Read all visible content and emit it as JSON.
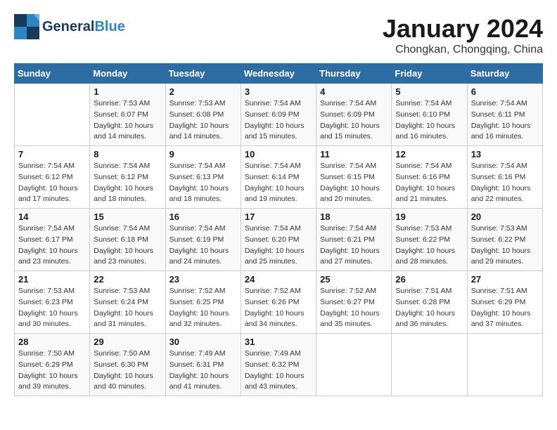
{
  "header": {
    "logo_line1": "General",
    "logo_line2": "Blue",
    "month": "January 2024",
    "location": "Chongkan, Chongqing, China"
  },
  "days_of_week": [
    "Sunday",
    "Monday",
    "Tuesday",
    "Wednesday",
    "Thursday",
    "Friday",
    "Saturday"
  ],
  "weeks": [
    [
      {
        "day": "",
        "info": ""
      },
      {
        "day": "1",
        "info": "Sunrise: 7:53 AM\nSunset: 6:07 PM\nDaylight: 10 hours\nand 14 minutes."
      },
      {
        "day": "2",
        "info": "Sunrise: 7:53 AM\nSunset: 6:08 PM\nDaylight: 10 hours\nand 14 minutes."
      },
      {
        "day": "3",
        "info": "Sunrise: 7:54 AM\nSunset: 6:09 PM\nDaylight: 10 hours\nand 15 minutes."
      },
      {
        "day": "4",
        "info": "Sunrise: 7:54 AM\nSunset: 6:09 PM\nDaylight: 10 hours\nand 15 minutes."
      },
      {
        "day": "5",
        "info": "Sunrise: 7:54 AM\nSunset: 6:10 PM\nDaylight: 10 hours\nand 16 minutes."
      },
      {
        "day": "6",
        "info": "Sunrise: 7:54 AM\nSunset: 6:11 PM\nDaylight: 10 hours\nand 16 minutes."
      }
    ],
    [
      {
        "day": "7",
        "info": "Sunrise: 7:54 AM\nSunset: 6:12 PM\nDaylight: 10 hours\nand 17 minutes."
      },
      {
        "day": "8",
        "info": "Sunrise: 7:54 AM\nSunset: 6:12 PM\nDaylight: 10 hours\nand 18 minutes."
      },
      {
        "day": "9",
        "info": "Sunrise: 7:54 AM\nSunset: 6:13 PM\nDaylight: 10 hours\nand 18 minutes."
      },
      {
        "day": "10",
        "info": "Sunrise: 7:54 AM\nSunset: 6:14 PM\nDaylight: 10 hours\nand 19 minutes."
      },
      {
        "day": "11",
        "info": "Sunrise: 7:54 AM\nSunset: 6:15 PM\nDaylight: 10 hours\nand 20 minutes."
      },
      {
        "day": "12",
        "info": "Sunrise: 7:54 AM\nSunset: 6:16 PM\nDaylight: 10 hours\nand 21 minutes."
      },
      {
        "day": "13",
        "info": "Sunrise: 7:54 AM\nSunset: 6:16 PM\nDaylight: 10 hours\nand 22 minutes."
      }
    ],
    [
      {
        "day": "14",
        "info": "Sunrise: 7:54 AM\nSunset: 6:17 PM\nDaylight: 10 hours\nand 23 minutes."
      },
      {
        "day": "15",
        "info": "Sunrise: 7:54 AM\nSunset: 6:18 PM\nDaylight: 10 hours\nand 23 minutes."
      },
      {
        "day": "16",
        "info": "Sunrise: 7:54 AM\nSunset: 6:19 PM\nDaylight: 10 hours\nand 24 minutes."
      },
      {
        "day": "17",
        "info": "Sunrise: 7:54 AM\nSunset: 6:20 PM\nDaylight: 10 hours\nand 25 minutes."
      },
      {
        "day": "18",
        "info": "Sunrise: 7:54 AM\nSunset: 6:21 PM\nDaylight: 10 hours\nand 27 minutes."
      },
      {
        "day": "19",
        "info": "Sunrise: 7:53 AM\nSunset: 6:22 PM\nDaylight: 10 hours\nand 28 minutes."
      },
      {
        "day": "20",
        "info": "Sunrise: 7:53 AM\nSunset: 6:22 PM\nDaylight: 10 hours\nand 29 minutes."
      }
    ],
    [
      {
        "day": "21",
        "info": "Sunrise: 7:53 AM\nSunset: 6:23 PM\nDaylight: 10 hours\nand 30 minutes."
      },
      {
        "day": "22",
        "info": "Sunrise: 7:53 AM\nSunset: 6:24 PM\nDaylight: 10 hours\nand 31 minutes."
      },
      {
        "day": "23",
        "info": "Sunrise: 7:52 AM\nSunset: 6:25 PM\nDaylight: 10 hours\nand 32 minutes."
      },
      {
        "day": "24",
        "info": "Sunrise: 7:52 AM\nSunset: 6:26 PM\nDaylight: 10 hours\nand 34 minutes."
      },
      {
        "day": "25",
        "info": "Sunrise: 7:52 AM\nSunset: 6:27 PM\nDaylight: 10 hours\nand 35 minutes."
      },
      {
        "day": "26",
        "info": "Sunrise: 7:51 AM\nSunset: 6:28 PM\nDaylight: 10 hours\nand 36 minutes."
      },
      {
        "day": "27",
        "info": "Sunrise: 7:51 AM\nSunset: 6:29 PM\nDaylight: 10 hours\nand 37 minutes."
      }
    ],
    [
      {
        "day": "28",
        "info": "Sunrise: 7:50 AM\nSunset: 6:29 PM\nDaylight: 10 hours\nand 39 minutes."
      },
      {
        "day": "29",
        "info": "Sunrise: 7:50 AM\nSunset: 6:30 PM\nDaylight: 10 hours\nand 40 minutes."
      },
      {
        "day": "30",
        "info": "Sunrise: 7:49 AM\nSunset: 6:31 PM\nDaylight: 10 hours\nand 41 minutes."
      },
      {
        "day": "31",
        "info": "Sunrise: 7:49 AM\nSunset: 6:32 PM\nDaylight: 10 hours\nand 43 minutes."
      },
      {
        "day": "",
        "info": ""
      },
      {
        "day": "",
        "info": ""
      },
      {
        "day": "",
        "info": ""
      }
    ]
  ]
}
